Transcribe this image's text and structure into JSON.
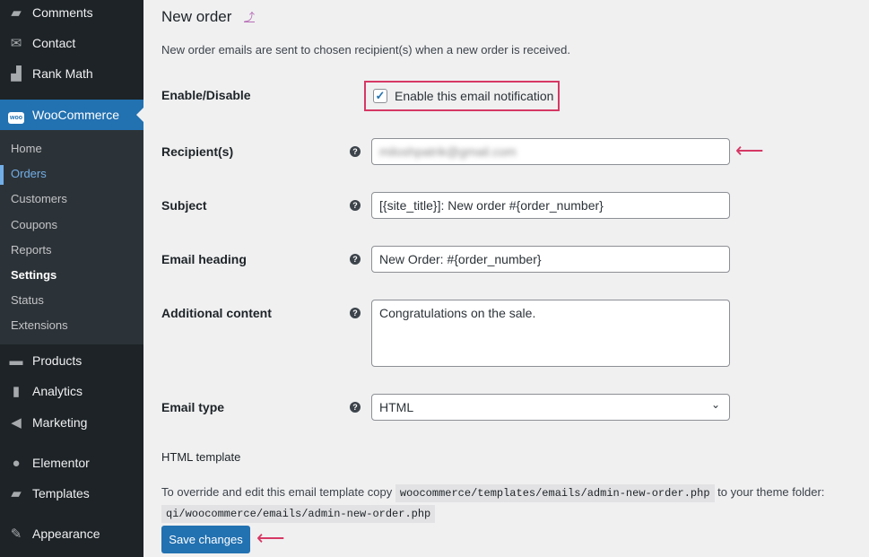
{
  "sidebar": {
    "items": [
      {
        "label": "Comments",
        "icon": "comment-icon"
      },
      {
        "label": "Contact",
        "icon": "mail-icon"
      },
      {
        "label": "Rank Math",
        "icon": "chart-icon"
      },
      {
        "label": "WooCommerce",
        "icon": "woo-icon"
      },
      {
        "label": "Products",
        "icon": "archive-icon"
      },
      {
        "label": "Analytics",
        "icon": "bar-chart-icon"
      },
      {
        "label": "Marketing",
        "icon": "megaphone-icon"
      },
      {
        "label": "Elementor",
        "icon": "elementor-icon"
      },
      {
        "label": "Templates",
        "icon": "folder-icon"
      },
      {
        "label": "Appearance",
        "icon": "brush-icon"
      }
    ],
    "submenu": [
      "Home",
      "Orders",
      "Customers",
      "Coupons",
      "Reports",
      "Settings",
      "Status",
      "Extensions"
    ]
  },
  "main": {
    "title": "New order",
    "up_link": "⤴",
    "description": "New order emails are sent to chosen recipient(s) when a new order is received.",
    "enable_label": "Enable/Disable",
    "enable_text": "Enable this email notification",
    "enabled": true,
    "recipient_label": "Recipient(s)",
    "recipient_value": "miloshpatrik@gmail.com",
    "subject_label": "Subject",
    "subject_value": "[{site_title}]: New order #{order_number}",
    "heading_label": "Email heading",
    "heading_value": "New Order: #{order_number}",
    "content_label": "Additional content",
    "content_value": "Congratulations on the sale.",
    "type_label": "Email type",
    "type_value": "HTML",
    "template_label": "HTML template",
    "template_text1": "To override and edit this email template copy",
    "template_code1": "woocommerce/templates/emails/admin-new-order.php",
    "template_text2": "to your theme folder:",
    "template_code2": "qi/woocommerce/emails/admin-new-order.php",
    "save_label": "Save changes"
  },
  "colors": {
    "accent": "#2271b1",
    "highlight": "#d63864"
  }
}
